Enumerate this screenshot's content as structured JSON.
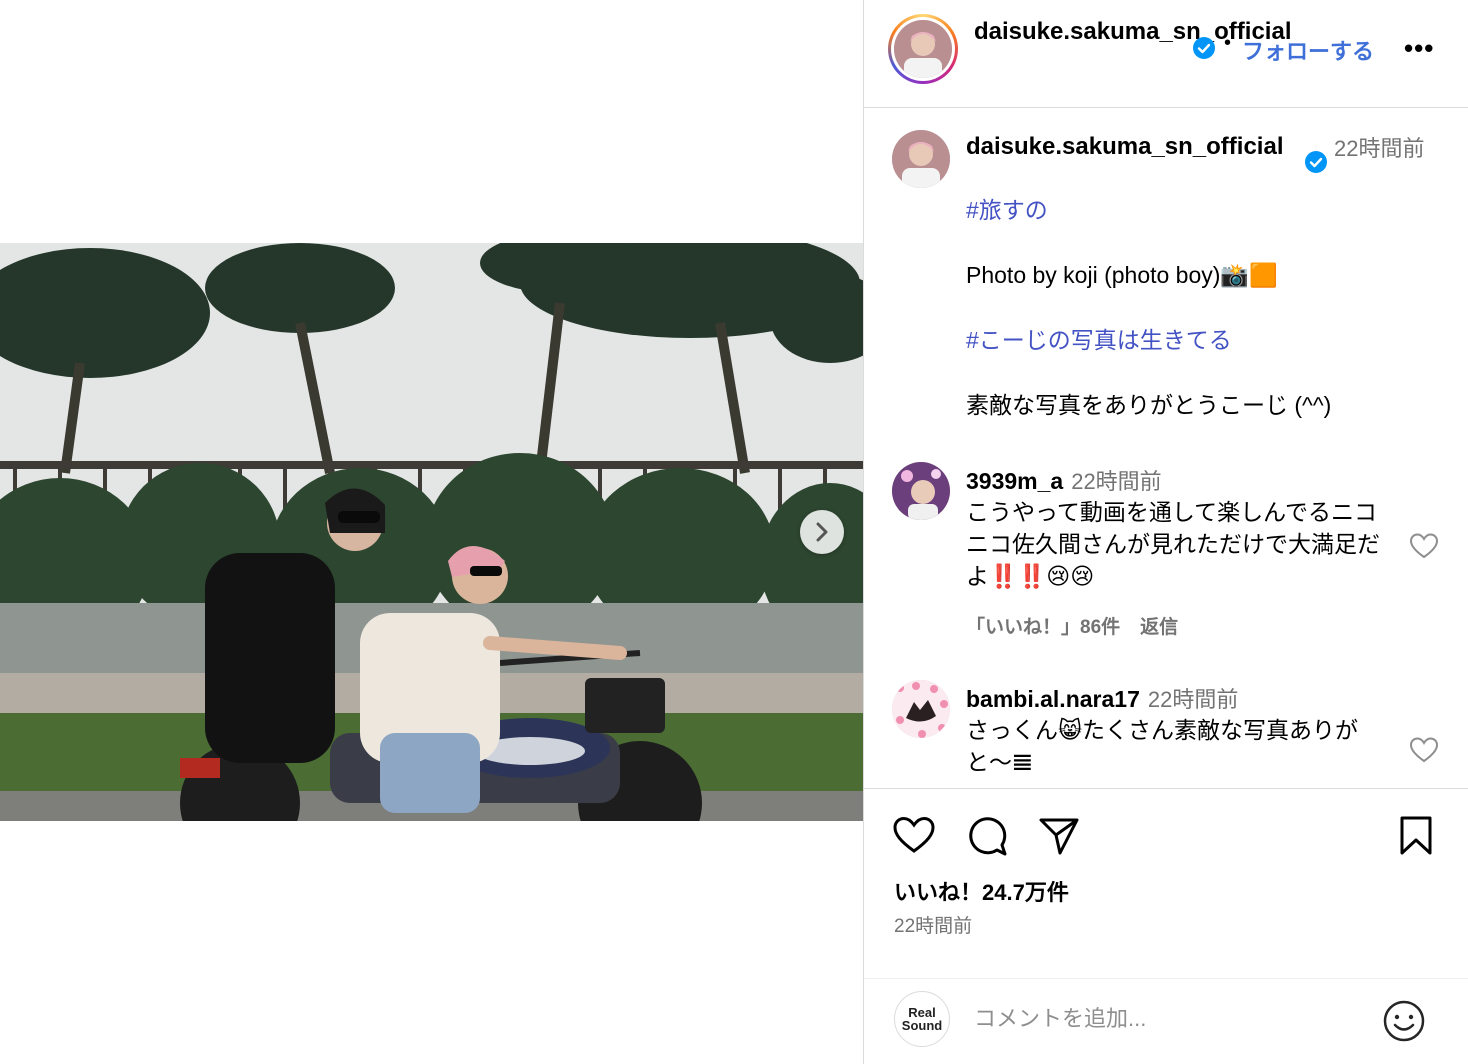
{
  "post": {
    "image_alt": "Two people riding a motorcycle in front of trees and a fence",
    "next_icon": "chevron-right-icon"
  },
  "header": {
    "username": "daisuke.sakuma_sn_official",
    "separator": "•",
    "follow_label": "フォローする",
    "more_label": "•••"
  },
  "caption": {
    "username": "daisuke.sakuma_sn_official",
    "time": "22時間前",
    "lines": [
      "#旅すの",
      "Photo by koji (photo boy)📸🟧",
      "#こーじの写真は生きてる",
      "素敵な写真をありがとうこーじ (^^)"
    ]
  },
  "comments": [
    {
      "username": "3939m_a",
      "time": "22時間前",
      "text": "こうやって動画を通して楽しんでるニコニコ佐久間さんが見れただけで大満足だよ‼️‼️😢😢",
      "likes": "「いいね！」86件",
      "reply": "返信"
    },
    {
      "username": "bambi.al.nara17",
      "time": "22時間前",
      "text": "さっくん😸たくさん素敵な写真ありがと〜𝌆"
    }
  ],
  "actions": {
    "likes": "いいね！24.7万件",
    "posted": "22時間前"
  },
  "add_comment": {
    "logo_line1": "Real",
    "logo_line2": "Sound",
    "placeholder": "コメントを追加..."
  },
  "colors": {
    "link": "#3f6fd8",
    "hashtag": "#4453c4",
    "verified": "#0095f6",
    "muted": "#737373"
  }
}
